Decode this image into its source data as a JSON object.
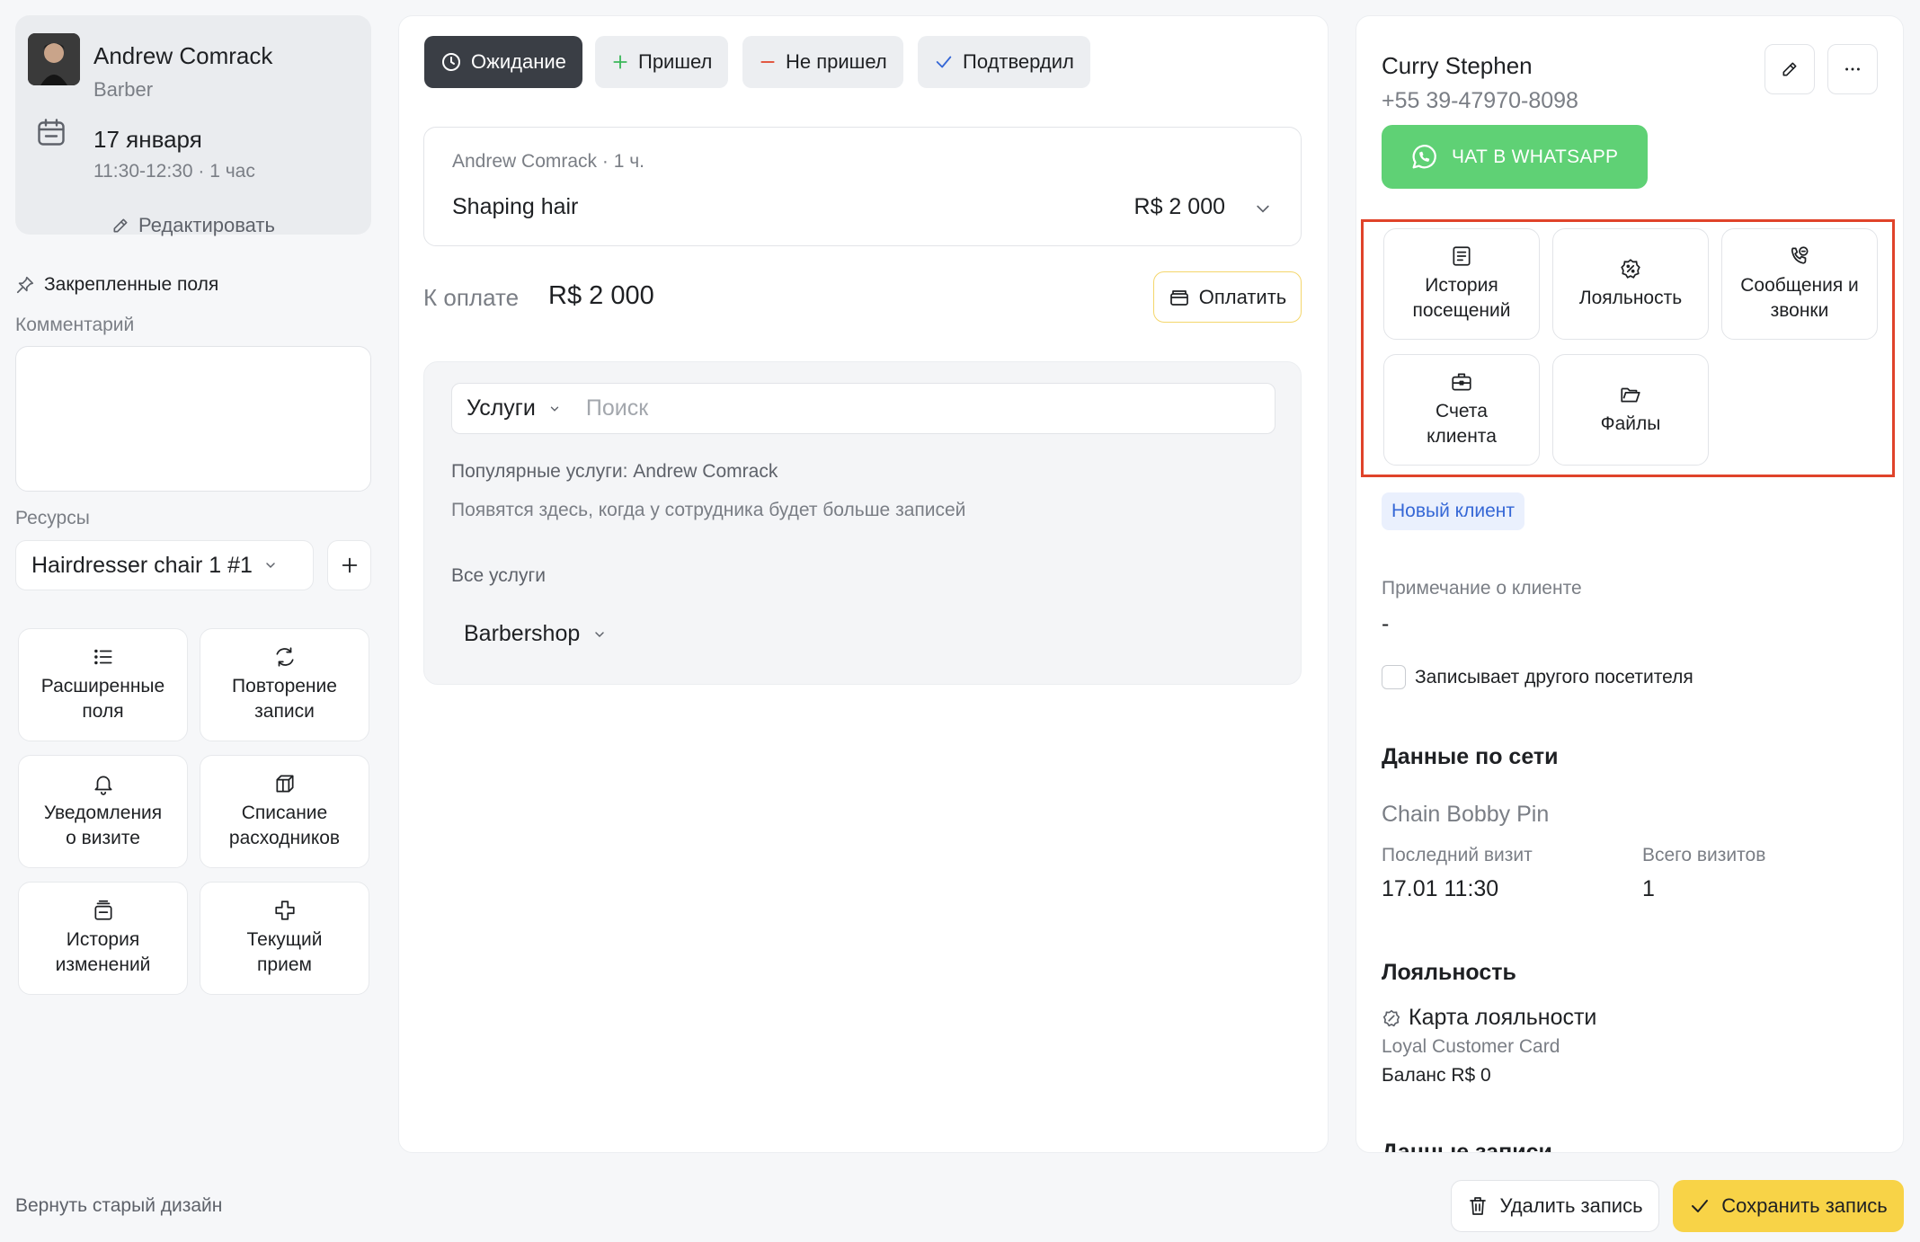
{
  "staff": {
    "name": "Andrew Comrack",
    "role": "Barber",
    "date": "17 января",
    "time": "11:30-12:30 · 1 час",
    "edit_label": "Редактировать"
  },
  "pinned": {
    "title": "Закрепленные поля",
    "comment_label": "Комментарий",
    "resources_label": "Ресурсы",
    "resource_value": "Hairdresser chair 1 #1"
  },
  "left_tiles": [
    {
      "label": "Расширенные\nполя",
      "icon": "list-icon"
    },
    {
      "label": "Повторение\nзаписи",
      "icon": "repeat-icon"
    },
    {
      "label": "Уведомления\nо визите",
      "icon": "bell-icon"
    },
    {
      "label": "Списание\nрасходников",
      "icon": "box-icon"
    },
    {
      "label": "История\nизменений",
      "icon": "history-icon"
    },
    {
      "label": "Текущий\nприем",
      "icon": "medical-cross-icon"
    }
  ],
  "footer": {
    "old_design": "Вернуть старый дизайн",
    "delete_label": "Удалить запись",
    "save_label": "Сохранить запись"
  },
  "statuses": [
    {
      "label": "Ожидание",
      "icon": "clock-icon",
      "active": true
    },
    {
      "label": "Пришел",
      "icon": "plus-icon",
      "color": "#3bb85a"
    },
    {
      "label": "Не пришел",
      "icon": "minus-icon",
      "color": "#e0432a"
    },
    {
      "label": "Подтвердил",
      "icon": "check-icon",
      "color": "#3567d6"
    }
  ],
  "service": {
    "meta": "Andrew Comrack · 1 ч.",
    "name": "Shaping hair",
    "price": "R$ 2 000"
  },
  "payment": {
    "label": "К оплате",
    "amount": "R$ 2 000",
    "pay_label": "Оплатить"
  },
  "services_search": {
    "dropdown": "Услуги",
    "placeholder": "Поиск",
    "popular_title": "Популярные услуги: Andrew Comrack",
    "popular_sub": "Появятся здесь, когда у сотрудника будет больше записей",
    "all_title": "Все услуги",
    "category": "Barbershop"
  },
  "client": {
    "name": "Curry Stephen",
    "phone": "+55 39-47970-8098",
    "whatsapp_label": "ЧАТ В WHATSAPP",
    "badge": "Новый клиент",
    "note_label": "Примечание о клиенте",
    "note_value": "-",
    "other_visitor": "Записывает другого посетителя"
  },
  "client_tiles": [
    {
      "label": "История\nпосещений",
      "icon": "visit-history-icon"
    },
    {
      "label": "Лояльность",
      "icon": "loyalty-icon"
    },
    {
      "label": "Сообщения и\nзвонки",
      "icon": "phone-message-icon"
    },
    {
      "label": "Счета\nклиента",
      "icon": "briefcase-icon"
    },
    {
      "label": "Файлы",
      "icon": "folder-icon"
    }
  ],
  "network": {
    "title": "Данные по сети",
    "chain": "Chain Bobby Pin",
    "last_visit_label": "Последний визит",
    "last_visit_value": "17.01 11:30",
    "total_label": "Всего визитов",
    "total_value": "1"
  },
  "loyalty": {
    "title": "Лояльность",
    "card_title": "Карта лояльности",
    "card_name": "Loyal Customer Card",
    "balance": "Баланс R$ 0"
  },
  "record": {
    "title": "Данные записи"
  },
  "colors": {
    "accent_yellow": "#f8d347",
    "whatsapp_green": "#5fd175",
    "highlight_red": "#e0432a",
    "badge_blue": "#3567d6"
  }
}
